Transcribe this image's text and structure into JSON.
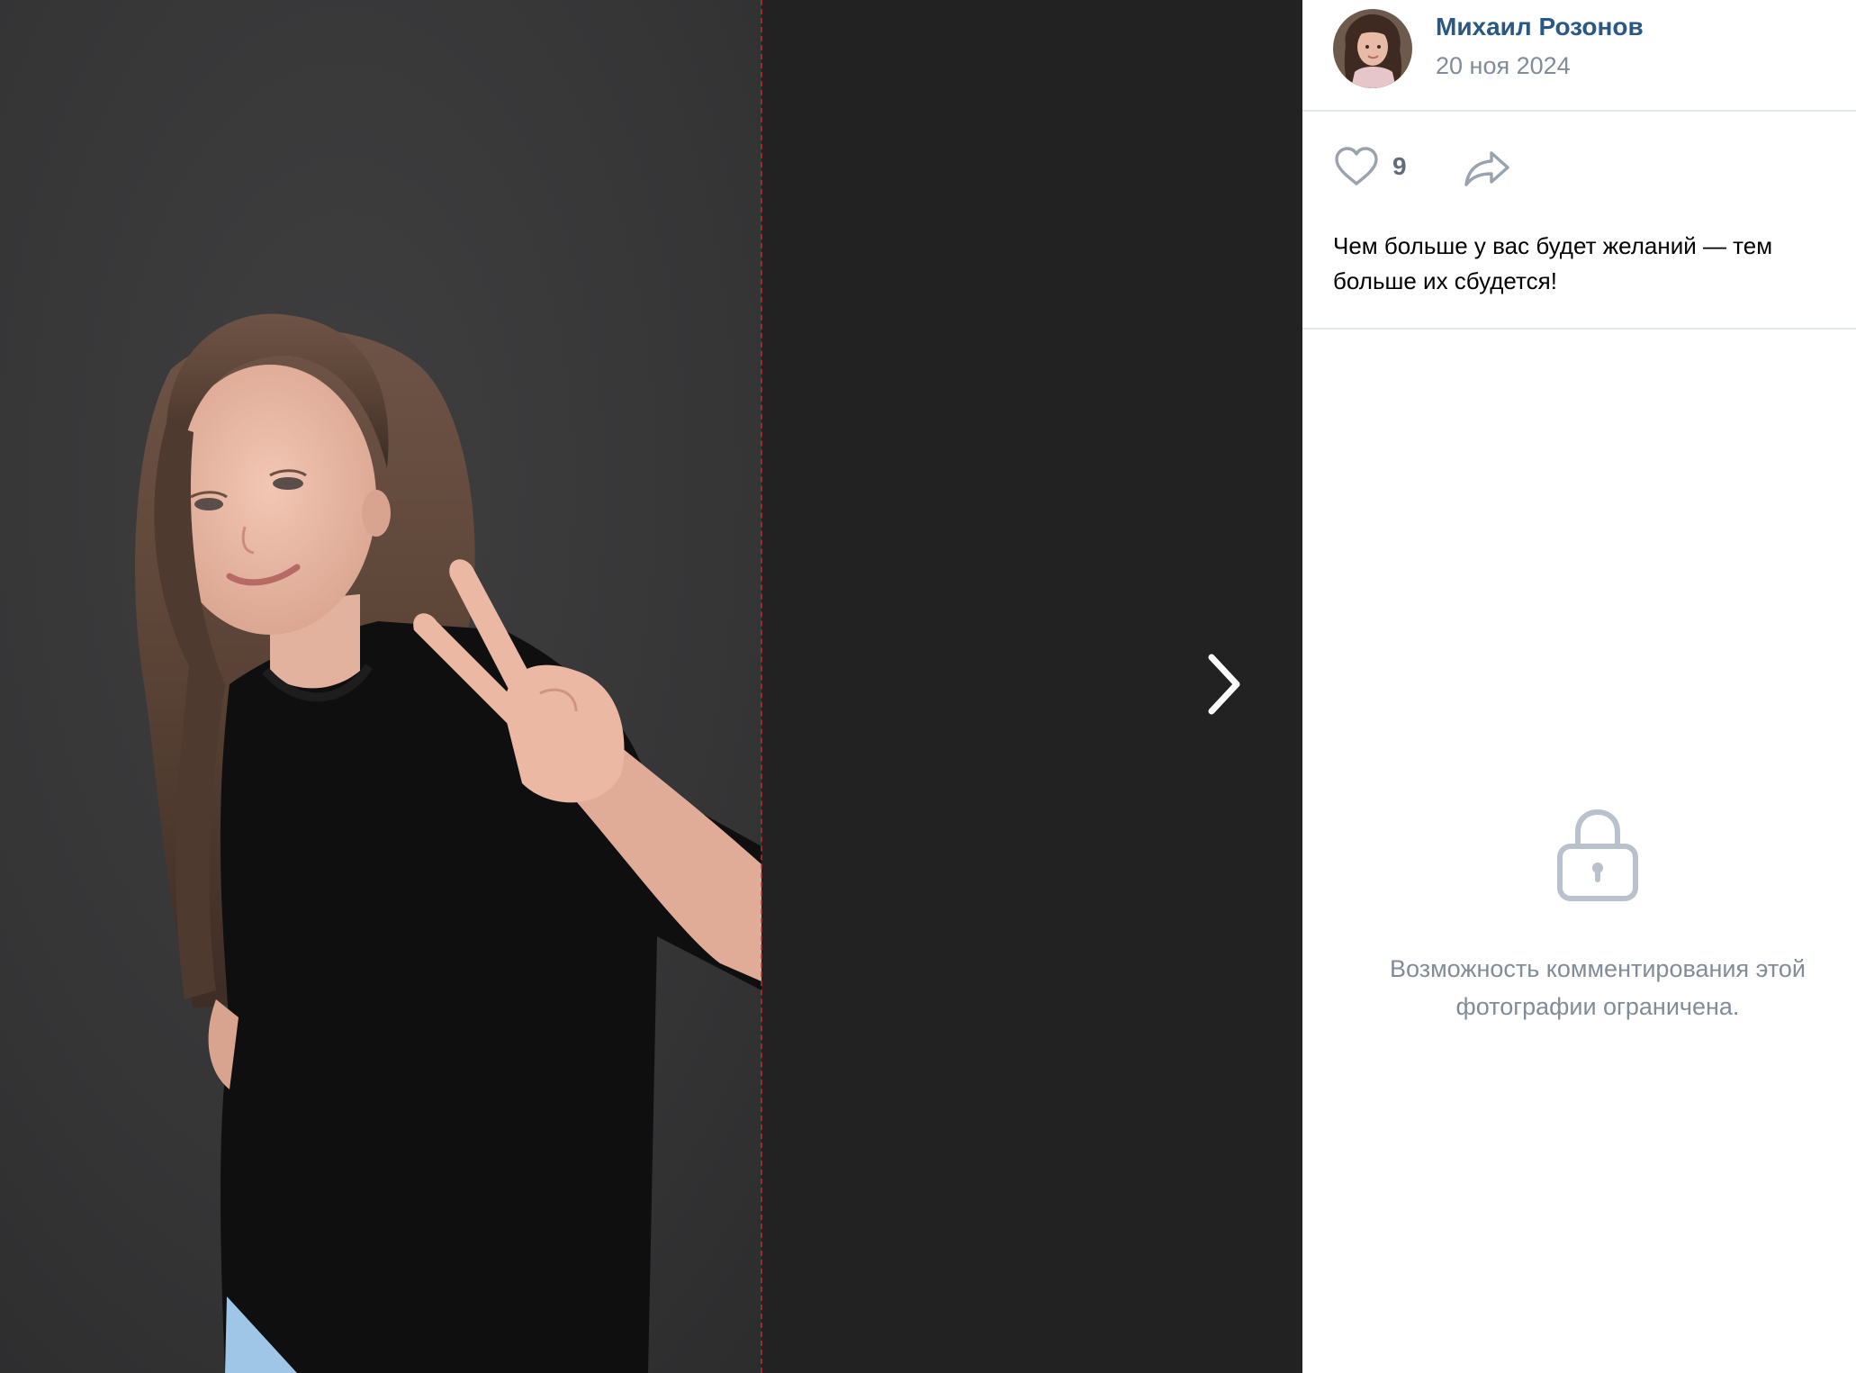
{
  "post": {
    "author_name": "Михаил Розонов",
    "date": "20 ноя 2024",
    "likes_count": "9",
    "caption": "Чем больше у вас будет желаний — тем больше их сбудется!"
  },
  "comments": {
    "locked_message": "Возможность комментирования этой фотографии ограничена."
  },
  "icons": {
    "like": "heart-icon",
    "share": "share-arrow-icon",
    "next": "chevron-right-icon",
    "lock": "lock-icon"
  },
  "colors": {
    "author_link": "#2a5885",
    "muted_text": "#818c99",
    "icon_gray": "#99a2ad",
    "stage_background": "#222222"
  }
}
